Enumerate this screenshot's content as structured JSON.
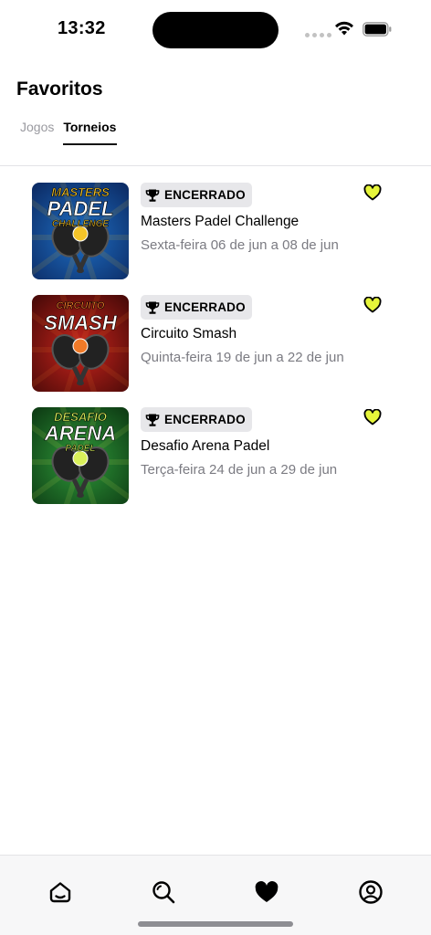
{
  "status_bar": {
    "time": "13:32"
  },
  "header": {
    "title": "Favoritos"
  },
  "tabs": [
    {
      "label": "Jogos",
      "active": false
    },
    {
      "label": "Torneios",
      "active": true
    }
  ],
  "tournaments": [
    {
      "status": "ENCERRADO",
      "name": "Masters Padel Challenge",
      "date": "Sexta-feira 06 de jun a 08 de jun",
      "poster_lines": [
        "MASTERS",
        "PADEL",
        "CHALLENGE"
      ],
      "poster_colors": [
        "#1f6fc4",
        "#0c2c66",
        "#f5c428"
      ],
      "favorite": true
    },
    {
      "status": "ENCERRADO",
      "name": "Circuito Smash",
      "date": "Quinta-feira 19 de jun a 22 de jun",
      "poster_lines": [
        "CIRCUITO",
        "SMASH"
      ],
      "poster_colors": [
        "#c8241c",
        "#4a0a08",
        "#f07a28"
      ],
      "favorite": true
    },
    {
      "status": "ENCERRADO",
      "name": "Desafio Arena Padel",
      "date": "Terça-feira 24 de jun a 29 de jun",
      "poster_lines": [
        "DESAFIO",
        "ARENA",
        "PADEL"
      ],
      "poster_colors": [
        "#2f9a3a",
        "#0e3d14",
        "#d9f05a"
      ],
      "favorite": true
    }
  ],
  "bottom_nav": [
    {
      "icon": "home-icon",
      "active": false
    },
    {
      "icon": "search-icon",
      "active": false
    },
    {
      "icon": "heart-icon",
      "active": true
    },
    {
      "icon": "profile-icon",
      "active": false
    }
  ],
  "colors": {
    "favorite_heart": "#e6f53a",
    "badge_bg": "#e7e7ea",
    "date_text": "#7b7b82"
  }
}
